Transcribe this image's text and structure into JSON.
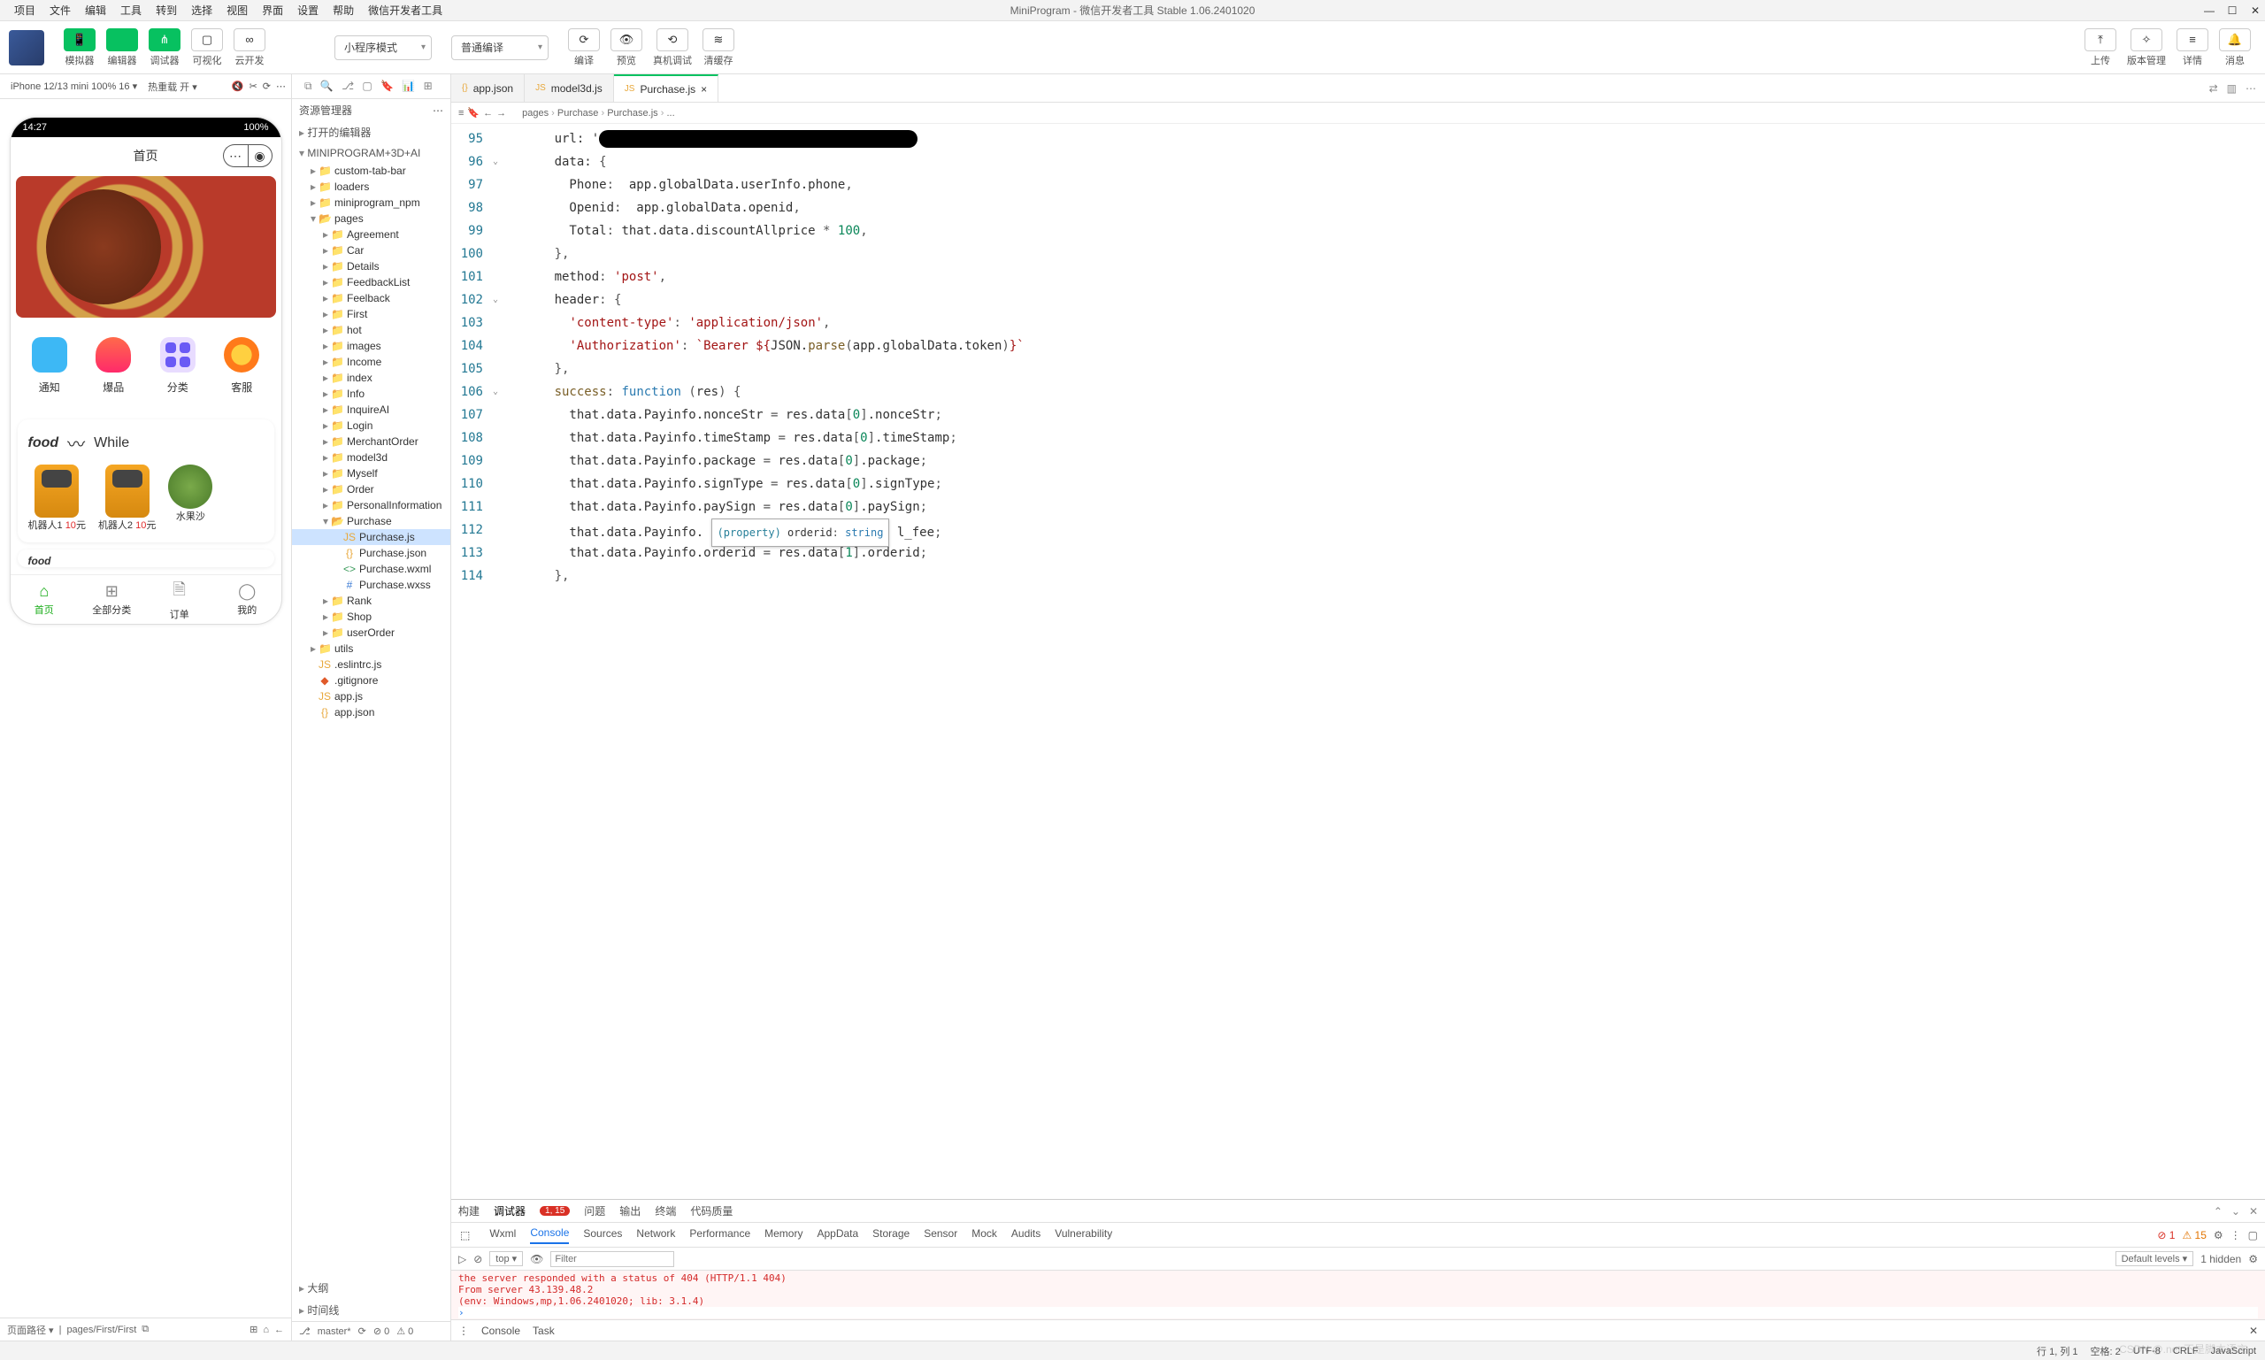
{
  "menubar": {
    "items": [
      "项目",
      "文件",
      "编辑",
      "工具",
      "转到",
      "选择",
      "视图",
      "界面",
      "设置",
      "帮助",
      "微信开发者工具"
    ],
    "title": "MiniProgram - 微信开发者工具 Stable 1.06.2401020"
  },
  "toolbar": {
    "buttons": [
      {
        "icon": "📱",
        "label": "模拟器",
        "green": true
      },
      {
        "icon": "</>",
        "label": "编辑器",
        "green": true
      },
      {
        "icon": "⋔",
        "label": "调试器",
        "green": true
      },
      {
        "icon": "▢",
        "label": "可视化",
        "green": false
      },
      {
        "icon": "∞",
        "label": "云开发",
        "green": false
      }
    ],
    "mode_select": "小程序模式",
    "compile_select": "普通编译",
    "right_buttons": [
      {
        "icon": "⟳",
        "label": "编译"
      },
      {
        "icon": "👁",
        "label": "预览"
      },
      {
        "icon": "⟲",
        "label": "真机调试"
      },
      {
        "icon": "≋",
        "label": "清缓存"
      }
    ],
    "far_right": [
      {
        "icon": "⤒",
        "label": "上传"
      },
      {
        "icon": "✧",
        "label": "版本管理"
      },
      {
        "icon": "≡",
        "label": "详情"
      },
      {
        "icon": "🔔",
        "label": "消息"
      }
    ]
  },
  "simulator": {
    "device": "iPhone 12/13 mini 100% 16 ▾",
    "hot": "热重载 开 ▾",
    "time": "14:27",
    "battery": "100%",
    "page_title": "首页",
    "quick": [
      {
        "label": "通知"
      },
      {
        "label": "爆品"
      },
      {
        "label": "分类"
      },
      {
        "label": "客服"
      }
    ],
    "card_title": "While",
    "card_brand": "food",
    "products": [
      {
        "name": "机器人1",
        "price": "10",
        "unit": "元"
      },
      {
        "name": "机器人2",
        "price": "10",
        "unit": "元"
      },
      {
        "name": "水果沙",
        "price": "",
        "unit": ""
      }
    ],
    "tabs": [
      {
        "label": "首页",
        "icon": "⌂"
      },
      {
        "label": "全部分类",
        "icon": "⊞"
      },
      {
        "label": "订单",
        "icon": "🗎"
      },
      {
        "label": "我的",
        "icon": "◯"
      }
    ],
    "footer_label": "页面路径 ▾",
    "footer_path": "pages/First/First"
  },
  "explorer": {
    "title": "资源管理器",
    "sect_open": "打开的编辑器",
    "project": "MINIPROGRAM+3D+AI",
    "tree": [
      {
        "d": 1,
        "c": "▸",
        "t": "folder",
        "n": "custom-tab-bar"
      },
      {
        "d": 1,
        "c": "▸",
        "t": "folder",
        "n": "loaders"
      },
      {
        "d": 1,
        "c": "▸",
        "t": "folder",
        "n": "miniprogram_npm"
      },
      {
        "d": 1,
        "c": "▾",
        "t": "folder-open",
        "n": "pages"
      },
      {
        "d": 2,
        "c": "▸",
        "t": "folder",
        "n": "Agreement"
      },
      {
        "d": 2,
        "c": "▸",
        "t": "folder",
        "n": "Car"
      },
      {
        "d": 2,
        "c": "▸",
        "t": "folder",
        "n": "Details"
      },
      {
        "d": 2,
        "c": "▸",
        "t": "folder",
        "n": "FeedbackList"
      },
      {
        "d": 2,
        "c": "▸",
        "t": "folder",
        "n": "Feelback"
      },
      {
        "d": 2,
        "c": "▸",
        "t": "folder",
        "n": "First"
      },
      {
        "d": 2,
        "c": "▸",
        "t": "folder",
        "n": "hot"
      },
      {
        "d": 2,
        "c": "▸",
        "t": "folder",
        "n": "images"
      },
      {
        "d": 2,
        "c": "▸",
        "t": "folder",
        "n": "Income"
      },
      {
        "d": 2,
        "c": "▸",
        "t": "folder",
        "n": "index"
      },
      {
        "d": 2,
        "c": "▸",
        "t": "folder",
        "n": "Info"
      },
      {
        "d": 2,
        "c": "▸",
        "t": "folder",
        "n": "InquireAI"
      },
      {
        "d": 2,
        "c": "▸",
        "t": "folder",
        "n": "Login"
      },
      {
        "d": 2,
        "c": "▸",
        "t": "folder",
        "n": "MerchantOrder"
      },
      {
        "d": 2,
        "c": "▸",
        "t": "folder",
        "n": "model3d"
      },
      {
        "d": 2,
        "c": "▸",
        "t": "folder",
        "n": "Myself"
      },
      {
        "d": 2,
        "c": "▸",
        "t": "folder",
        "n": "Order"
      },
      {
        "d": 2,
        "c": "▸",
        "t": "folder",
        "n": "PersonalInformation"
      },
      {
        "d": 2,
        "c": "▾",
        "t": "folder-open",
        "n": "Purchase"
      },
      {
        "d": 3,
        "c": " ",
        "t": "js",
        "n": "Purchase.js",
        "sel": true
      },
      {
        "d": 3,
        "c": " ",
        "t": "json",
        "n": "Purchase.json"
      },
      {
        "d": 3,
        "c": " ",
        "t": "wxml",
        "n": "Purchase.wxml"
      },
      {
        "d": 3,
        "c": " ",
        "t": "wxss",
        "n": "Purchase.wxss"
      },
      {
        "d": 2,
        "c": "▸",
        "t": "folder",
        "n": "Rank"
      },
      {
        "d": 2,
        "c": "▸",
        "t": "folder",
        "n": "Shop"
      },
      {
        "d": 2,
        "c": "▸",
        "t": "folder",
        "n": "userOrder"
      },
      {
        "d": 1,
        "c": "▸",
        "t": "folder",
        "n": "utils"
      },
      {
        "d": 1,
        "c": " ",
        "t": "js",
        "n": ".eslintrc.js"
      },
      {
        "d": 1,
        "c": " ",
        "t": "git",
        "n": ".gitignore"
      },
      {
        "d": 1,
        "c": " ",
        "t": "js",
        "n": "app.js"
      },
      {
        "d": 1,
        "c": " ",
        "t": "json",
        "n": "app.json"
      }
    ],
    "outline": "大纲",
    "timeline": "时间线",
    "branch": "master*",
    "sync": "⟳",
    "err": "⊘ 0",
    "warn": "⚠ 0"
  },
  "editor": {
    "tabs": [
      {
        "icon": "{}",
        "name": "app.json",
        "active": false
      },
      {
        "icon": "JS",
        "name": "model3d.js",
        "active": false
      },
      {
        "icon": "JS",
        "name": "Purchase.js",
        "active": true
      }
    ],
    "breadcrumb": [
      "pages",
      "Purchase",
      "Purchase.js",
      "..."
    ],
    "line_start": 95,
    "lines": [
      {
        "html": "      url: '<span class=\"blackbox\"></span>"
      },
      {
        "html": "      data: <span class=\"tk-o\">{</span>"
      },
      {
        "html": "        Phone<span class=\"tk-o\">:</span>  app.globalData.userInfo.phone<span class=\"tk-o\">,</span>"
      },
      {
        "html": "        Openid<span class=\"tk-o\">:</span>  app.globalData.openid<span class=\"tk-o\">,</span>"
      },
      {
        "html": "        Total<span class=\"tk-o\">:</span> that.data.discountAllprice <span class=\"tk-o\">*</span> <span class=\"tk-n\">100</span><span class=\"tk-o\">,</span>"
      },
      {
        "html": "      <span class=\"tk-o\">},</span>"
      },
      {
        "html": "      method<span class=\"tk-o\">:</span> <span class=\"tk-s\">'post'</span><span class=\"tk-o\">,</span>"
      },
      {
        "html": "      header<span class=\"tk-o\">:</span> <span class=\"tk-o\">{</span>"
      },
      {
        "html": "        <span class=\"tk-s\">'content-type'</span><span class=\"tk-o\">:</span> <span class=\"tk-s\">'application/json'</span><span class=\"tk-o\">,</span>"
      },
      {
        "html": "        <span class=\"tk-s\">'Authorization'</span><span class=\"tk-o\">:</span> <span class=\"tk-s\">`Bearer ${</span>JSON.<span class=\"tk-f\">parse</span><span class=\"tk-o\">(</span>app.globalData.token<span class=\"tk-o\">)</span><span class=\"tk-s\">}`</span>"
      },
      {
        "html": "      <span class=\"tk-o\">},</span>"
      },
      {
        "html": "      <span class=\"tk-f\">success</span><span class=\"tk-o\">:</span> <span class=\"tk-k\">function</span> <span class=\"tk-o\">(</span>res<span class=\"tk-o\">)</span> <span class=\"tk-o\">{</span>"
      },
      {
        "html": "        that.data.Payinfo.nonceStr <span class=\"tk-o\">=</span> res.data<span class=\"tk-o\">[</span><span class=\"tk-n\">0</span><span class=\"tk-o\">]</span>.nonceStr<span class=\"tk-o\">;</span>"
      },
      {
        "html": "        that.data.Payinfo.timeStamp <span class=\"tk-o\">=</span> res.data<span class=\"tk-o\">[</span><span class=\"tk-n\">0</span><span class=\"tk-o\">]</span>.timeStamp<span class=\"tk-o\">;</span>"
      },
      {
        "html": "        that.data.Payinfo.package <span class=\"tk-o\">=</span> res.data<span class=\"tk-o\">[</span><span class=\"tk-n\">0</span><span class=\"tk-o\">]</span>.package<span class=\"tk-o\">;</span>"
      },
      {
        "html": "        that.data.Payinfo.signType <span class=\"tk-o\">=</span> res.data<span class=\"tk-o\">[</span><span class=\"tk-n\">0</span><span class=\"tk-o\">]</span>.signType<span class=\"tk-o\">;</span>"
      },
      {
        "html": "        that.data.Payinfo.paySign <span class=\"tk-o\">=</span> res.data<span class=\"tk-o\">[</span><span class=\"tk-n\">0</span><span class=\"tk-o\">]</span>.paySign<span class=\"tk-o\">;</span>"
      },
      {
        "html": "        that.data.Payinfo. <span class=\"hint\"><span class=\"tk-p\">(property)</span> orderid<span class=\"tk-o\">:</span> <span class=\"tk-k\">string</span></span> l_fee<span class=\"tk-o\">;</span>"
      },
      {
        "html": "        that.data.Payinfo.orderid <span class=\"tk-o\">=</span> res.data<span class=\"tk-o\">[</span><span class=\"tk-n\">1</span><span class=\"tk-o\">]</span>.orderid<span class=\"tk-o\">;</span>"
      },
      {
        "html": "      <span class=\"tk-o\">},</span>"
      }
    ],
    "folds": {
      "1": "⌄",
      "7": "⌄",
      "11": "⌄"
    }
  },
  "devtools": {
    "row1": [
      "构建",
      "调试器",
      "问题",
      "输出",
      "终端",
      "代码质量"
    ],
    "row1_active": 1,
    "row1_badge": "1, 15",
    "row2": [
      "Wxml",
      "Console",
      "Sources",
      "Network",
      "Performance",
      "Memory",
      "AppData",
      "Storage",
      "Sensor",
      "Mock",
      "Audits",
      "Vulnerability"
    ],
    "row2_active": 1,
    "err_count": "1",
    "warn_count": "15",
    "filter_top": "top",
    "filter_placeholder": "Filter",
    "levels": "Default levels ▾",
    "hidden": "1 hidden",
    "log": [
      "the server responded with a status of 404 (HTTP/1.1 404)",
      "From server 43.139.48.2",
      "(env: Windows,mp,1.06.2401020; lib: 3.1.4)"
    ],
    "bottom": [
      "Console",
      "Task"
    ]
  },
  "statusbar": {
    "items": [
      "行 1, 列 1",
      "空格: 2",
      "UTF-8",
      "CRLF",
      "JavaScript"
    ],
    "watermark": "CSDN @.net 不是脚本语言"
  }
}
